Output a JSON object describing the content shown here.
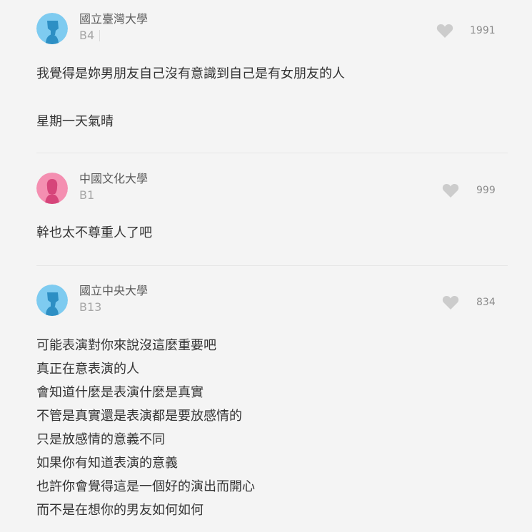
{
  "comments": [
    {
      "school": "國立臺灣大學",
      "floor": "B4",
      "likes": "1991",
      "avatar": "male-avatar-icon",
      "lines": [
        "我覺得是妳男朋友自己沒有意識到自己是有女朋友的人",
        "",
        "星期一天氣晴"
      ]
    },
    {
      "school": "中國文化大學",
      "floor": "B1",
      "likes": "999",
      "avatar": "female-avatar-icon",
      "lines": [
        "幹也太不尊重人了吧"
      ]
    },
    {
      "school": "國立中央大學",
      "floor": "B13",
      "likes": "834",
      "avatar": "male-avatar-icon",
      "lines": [
        "可能表演對你來說沒這麼重要吧",
        "真正在意表演的人",
        "會知道什麼是表演什麼是真實",
        "不管是真實還是表演都是要放感情的",
        "只是放感情的意義不同",
        "如果你有知道表演的意義",
        "也許你會覺得這是一個好的演出而開心",
        "而不是在想你的男友如何如何"
      ]
    }
  ],
  "colors": {
    "male_avatar_bg": "#7ecbf0",
    "male_avatar_figure": "#2d8fc4",
    "female_avatar_bg": "#f48fb1",
    "female_avatar_figure": "#d6457a",
    "like_icon": "#cccccc"
  }
}
